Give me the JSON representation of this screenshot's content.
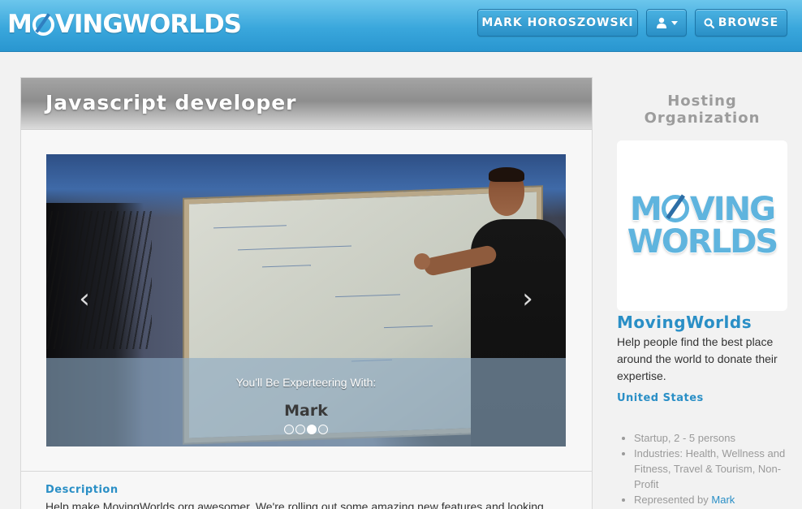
{
  "nav": {
    "logo_pre": "M",
    "logo_post": "VINGWORLDS",
    "user_label": "MARK HOROSZOWSKI",
    "user_icon": "user-icon",
    "browse_icon": "search-icon",
    "browse_label": "BROWSE"
  },
  "main": {
    "title": "Javascript developer",
    "carousel": {
      "prev_glyph": "‹",
      "next_glyph": "›",
      "caption_kicker": "You'll Be Experteering With:",
      "caption_name": "Mark",
      "slide_count": 4,
      "active_slide": 3
    },
    "description": {
      "heading": "Description",
      "text": "Help make MovingWorlds.org awesomer. We're rolling out some amazing new features and looking"
    }
  },
  "sidebar": {
    "heading": "Hosting Organization",
    "logo_line1_pre": "M",
    "logo_line1_post": "VING",
    "logo_line2": "WORLDS",
    "org_name": "MovingWorlds",
    "org_description": "Help people find the best place around the world to donate their expertise.",
    "country": "United States",
    "facts": [
      "Startup, 2 - 5 persons",
      "Industries: Health, Wellness and Fitness, Travel & Tourism, Non-Profit"
    ],
    "represented_prefix": "Represented by",
    "represented_link": "Mark"
  },
  "colors": {
    "brand_blue": "#2a8fc6",
    "navbar_blue": "#3aa7dc",
    "logo_light_blue": "#5fb4de",
    "muted_gray": "#9a9a9a"
  }
}
